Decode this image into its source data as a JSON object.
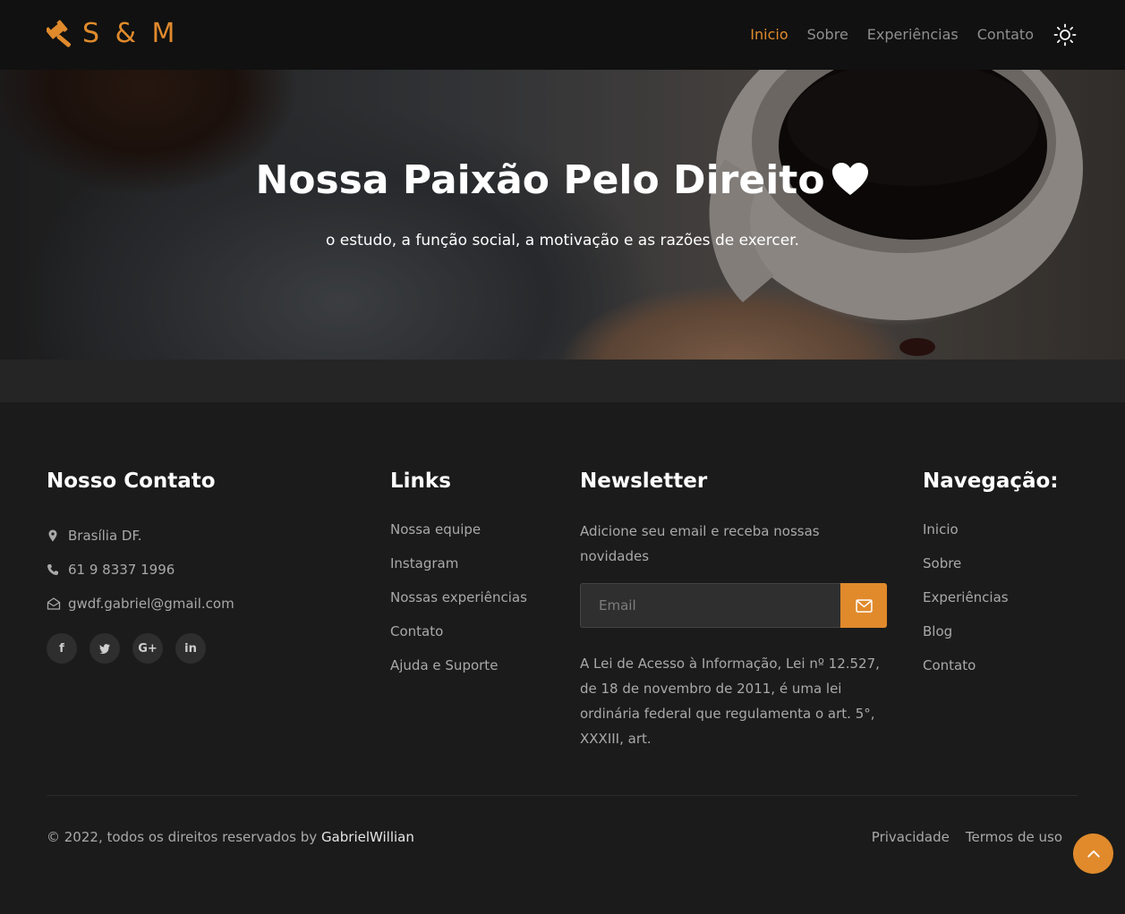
{
  "brand": {
    "name": "S & M",
    "accent": "#e08a2c"
  },
  "nav": {
    "items": [
      {
        "label": "Inicio",
        "active": true
      },
      {
        "label": "Sobre"
      },
      {
        "label": "Experiências"
      },
      {
        "label": "Contato"
      }
    ],
    "theme_icon": "sun-icon"
  },
  "hero": {
    "title": "Nossa Paixão Pelo Direito",
    "title_icon": "heart-icon",
    "subtitle": "o estudo, a função social, a motivação e as razões de exercer."
  },
  "footer": {
    "contact": {
      "title": "Nosso Contato",
      "location": "Brasília DF.",
      "phone": "61 9 8337 1996",
      "email": "gwdf.gabriel@gmail.com",
      "socials": [
        "facebook-icon",
        "twitter-icon",
        "google-plus-icon",
        "linkedin-icon"
      ]
    },
    "links": {
      "title": "Links",
      "items": [
        "Nossa equipe",
        "Instagram",
        "Nossas experiências",
        "Contato",
        "Ajuda e Suporte"
      ]
    },
    "newsletter": {
      "title": "Newsletter",
      "description": "Adicione seu email e receba nossas novidades",
      "placeholder": "Email",
      "law_text": "A Lei de Acesso à Informação, Lei nº 12.527, de 18 de novembro de 2011, é uma lei ordinária federal que regulamenta o art. 5°, XXXIII, art."
    },
    "navigation": {
      "title": "Navegação:",
      "items": [
        "Inicio",
        "Sobre",
        "Experiências",
        "Blog",
        "Contato"
      ]
    },
    "copyright_prefix": "© 2022, todos os direitos reservados by ",
    "copyright_author": "GabrielWillian",
    "bottom_links": [
      "Privacidade",
      "Termos de uso"
    ]
  }
}
